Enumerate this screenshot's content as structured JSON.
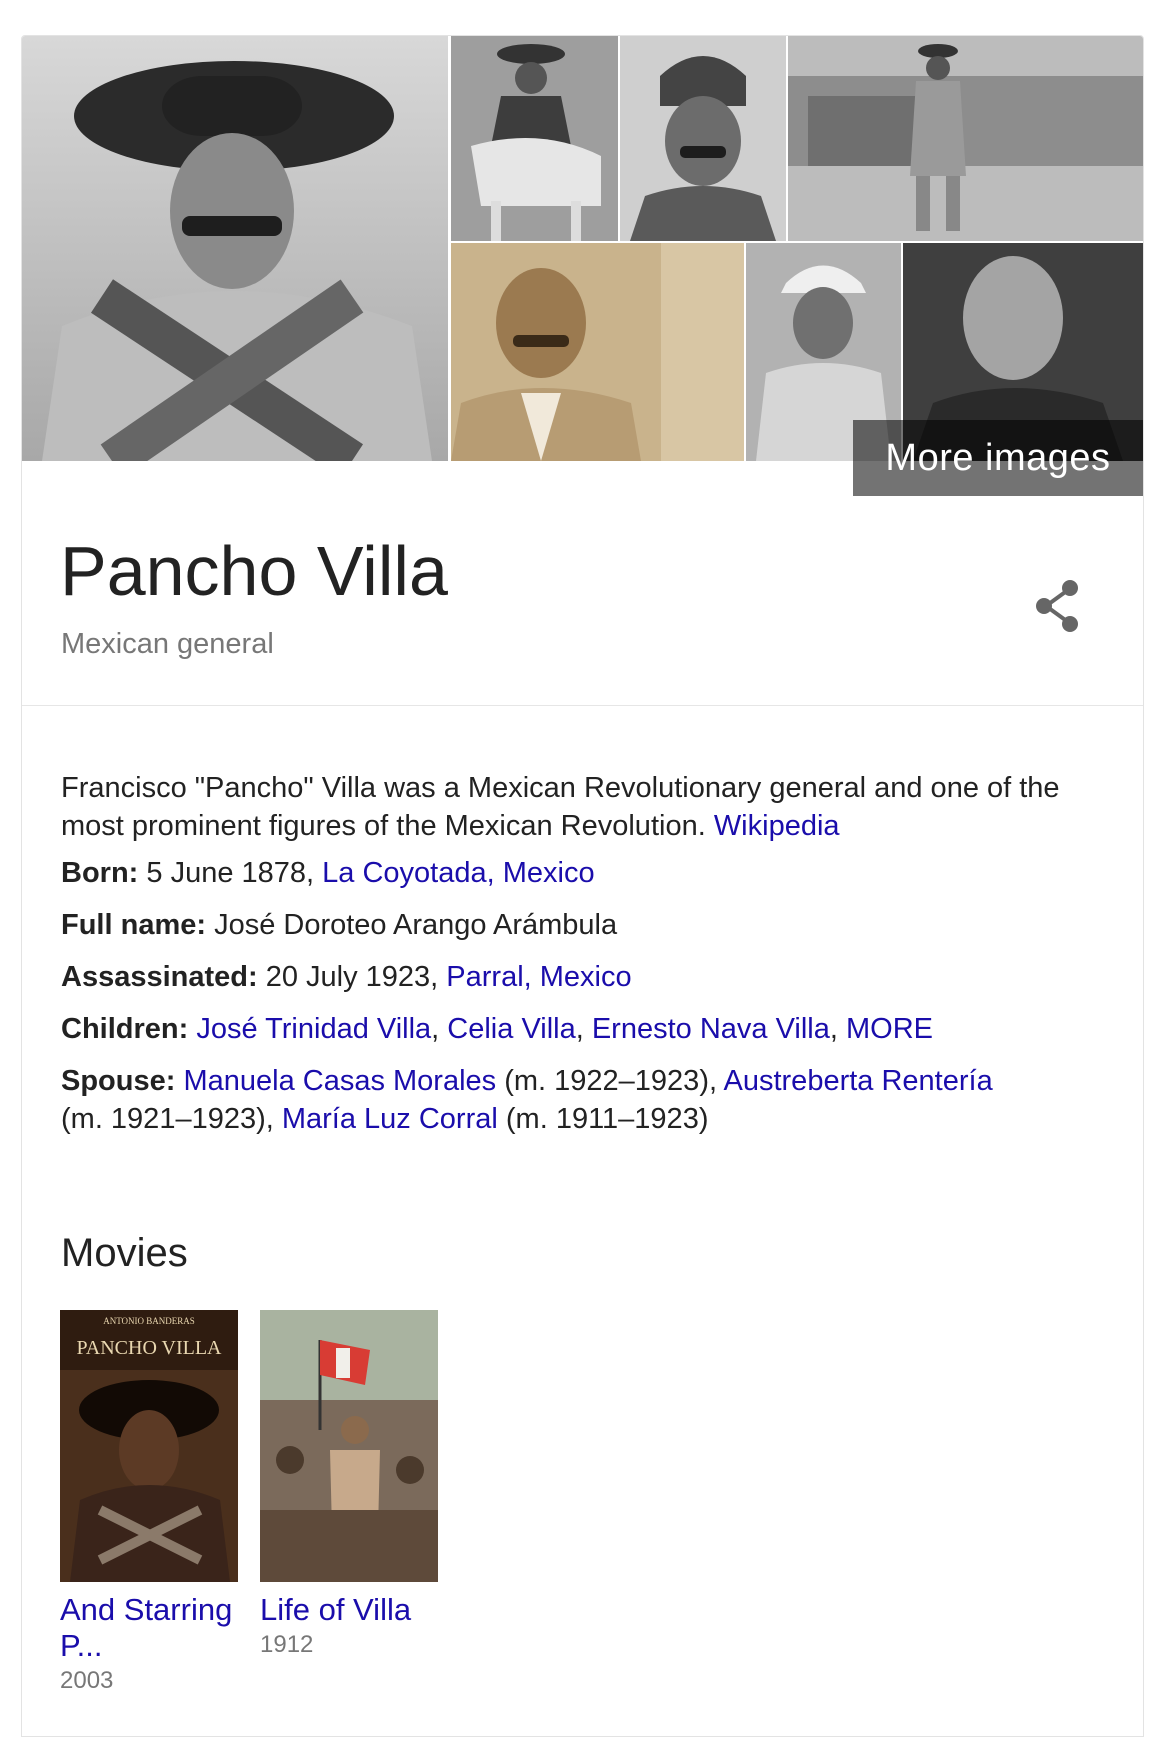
{
  "entity": {
    "title": "Pancho Villa",
    "subtitle": "Mexican general"
  },
  "images": {
    "more_label": "More images"
  },
  "description": {
    "text": "Francisco \"Pancho\" Villa was a Mexican Revolutionary general and one of the most prominent figures of the Mexican Revolution. ",
    "source_link": "Wikipedia"
  },
  "facts": {
    "born": {
      "label": "Born:",
      "value": " 5 June 1878, ",
      "place": "La Coyotada, Mexico"
    },
    "full_name": {
      "label": "Full name:",
      "value": " José Doroteo Arango Arámbula"
    },
    "assassinated": {
      "label": "Assassinated:",
      "value": " 20 July 1923, ",
      "place": "Parral, Mexico"
    },
    "children": {
      "label": "Children:",
      "items": [
        "José Trinidad Villa",
        "Celia Villa",
        "Ernesto Nava Villa"
      ],
      "more": "MORE"
    },
    "spouse": {
      "label": "Spouse:",
      "items": [
        {
          "name": "Manuela Casas Morales",
          "dates": " (m. 1922–1923), "
        },
        {
          "name": "Austreberta Rentería",
          "dates": " (m. 1921–1923), "
        },
        {
          "name": "María Luz Corral",
          "dates": " (m. 1911–1923)"
        }
      ]
    }
  },
  "movies": {
    "heading": "Movies",
    "items": [
      {
        "title": "And Starring P...",
        "year": "2003",
        "poster_text_top": "ANTONIO BANDERAS",
        "poster_text_main": "PANCHO VILLA"
      },
      {
        "title": "Life of Villa",
        "year": "1912"
      }
    ]
  },
  "colors": {
    "link": "#1a0dab",
    "muted": "#777777",
    "text": "#222222"
  }
}
